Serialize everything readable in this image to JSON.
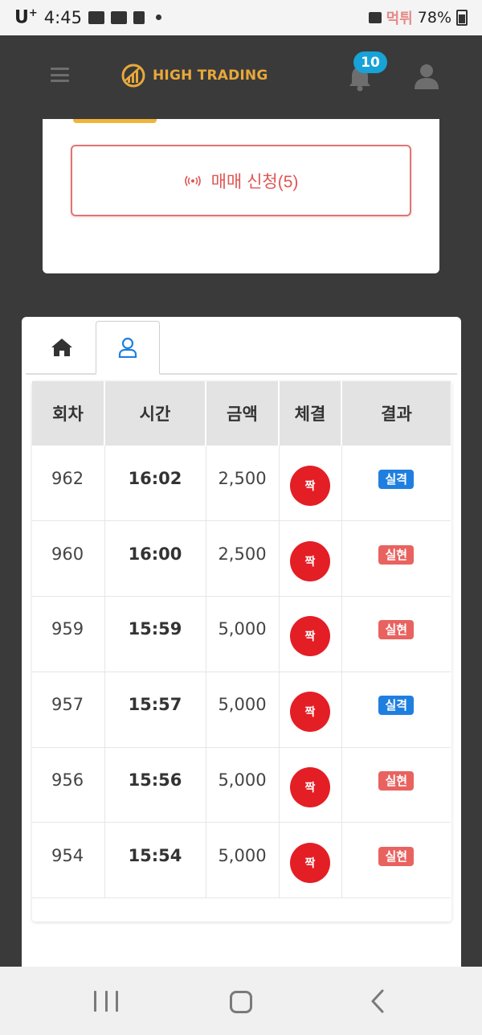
{
  "status_bar": {
    "carrier": "U",
    "carrier_sup": "+",
    "time": "4:45",
    "notification_icons": [
      "mail-icon",
      "youtube-icon",
      "feather-icon"
    ],
    "battery": "78%",
    "watermark": "먹튀"
  },
  "header": {
    "logo_text": "HIGH TRADING",
    "notification_count": "10",
    "icons": [
      "menu-icon",
      "bell-icon",
      "user-icon"
    ]
  },
  "trade_button": {
    "label": "매매 신청(5)",
    "icon": "radio-broadcast-icon"
  },
  "tabs": [
    {
      "name": "home",
      "icon": "home-icon",
      "active": false
    },
    {
      "name": "user",
      "icon": "user-outline-icon",
      "active": true
    }
  ],
  "table": {
    "columns": [
      "회차",
      "시간",
      "금액",
      "체결",
      "결과"
    ],
    "rows": [
      {
        "round": "962",
        "time": "16:02",
        "amount": "2,500",
        "trade": "짝",
        "result": "실격"
      },
      {
        "round": "960",
        "time": "16:00",
        "amount": "2,500",
        "trade": "짝",
        "result": "실현"
      },
      {
        "round": "959",
        "time": "15:59",
        "amount": "5,000",
        "trade": "짝",
        "result": "실현"
      },
      {
        "round": "957",
        "time": "15:57",
        "amount": "5,000",
        "trade": "짝",
        "result": "실격"
      },
      {
        "round": "956",
        "time": "15:56",
        "amount": "5,000",
        "trade": "짝",
        "result": "실현"
      },
      {
        "round": "954",
        "time": "15:54",
        "amount": "5,000",
        "trade": "짝",
        "result": "실현"
      }
    ]
  },
  "colors": {
    "accent_gold": "#e8a83a",
    "badge_blue": "#17a2d8",
    "trade_red": "#e41e25",
    "result_fail": "#1f7fe0",
    "result_realized": "#e8635f"
  },
  "nav_bar": [
    "recent-apps-icon",
    "home-button-icon",
    "back-icon"
  ]
}
